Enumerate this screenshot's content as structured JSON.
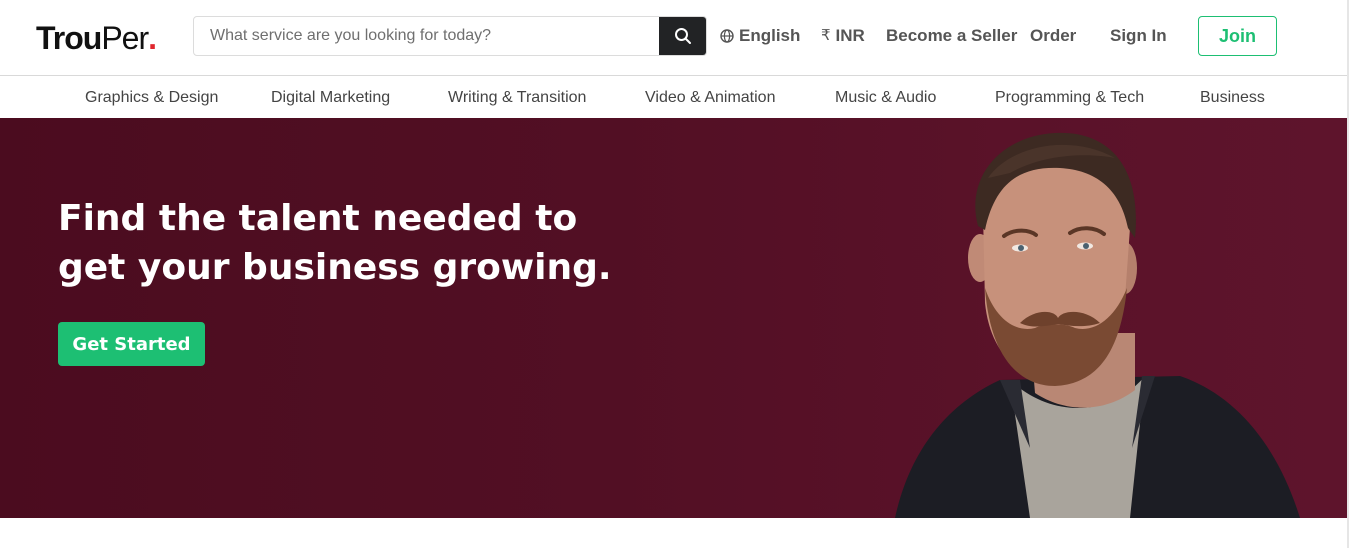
{
  "header": {
    "logo": {
      "part1": "Trou",
      "part2": "Per",
      "dot": "."
    },
    "search": {
      "placeholder": "What service are you looking for today?",
      "value": ""
    },
    "language": "English",
    "currency_symbol": "₹",
    "currency": "INR",
    "become_seller": "Become a Seller",
    "order": "Order",
    "sign_in": "Sign In",
    "join": "Join"
  },
  "categories": [
    "Graphics & Design",
    "Digital Marketing",
    "Writing & Transition",
    "Video & Animation",
    "Music & Audio",
    "Programming & Tech",
    "Business"
  ],
  "hero": {
    "title_line1": "Find the talent needed to",
    "title_line2": "get your business growing.",
    "cta": "Get Started"
  },
  "icons": {
    "search": "search-icon",
    "language": "globe-icon"
  },
  "colors": {
    "brand_green": "#1dbf73",
    "logo_dot": "#e0262e",
    "hero_bg": "#520f24",
    "search_button": "#222325"
  }
}
